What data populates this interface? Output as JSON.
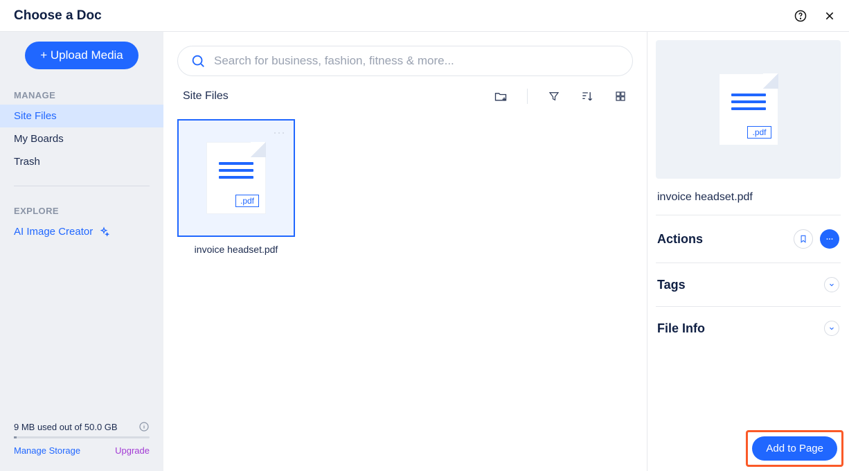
{
  "header": {
    "title": "Choose a Doc"
  },
  "sidebar": {
    "upload_label": "+ Upload Media",
    "manage_label": "MANAGE",
    "items": [
      {
        "label": "Site Files",
        "active": true
      },
      {
        "label": "My Boards",
        "active": false
      },
      {
        "label": "Trash",
        "active": false
      }
    ],
    "explore_label": "EXPLORE",
    "ai_item": "AI Image Creator",
    "storage_text": "9 MB used out of 50.0 GB",
    "manage_storage": "Manage Storage",
    "upgrade": "Upgrade"
  },
  "search": {
    "placeholder": "Search for business, fashion, fitness & more..."
  },
  "toolbar": {
    "title": "Site Files"
  },
  "files": [
    {
      "name": "invoice headset.pdf",
      "ext": ".pdf"
    }
  ],
  "details": {
    "file_name": "invoice headset.pdf",
    "file_ext": ".pdf",
    "actions_label": "Actions",
    "tags_label": "Tags",
    "fileinfo_label": "File Info"
  },
  "footer": {
    "add_to_page": "Add to Page"
  }
}
